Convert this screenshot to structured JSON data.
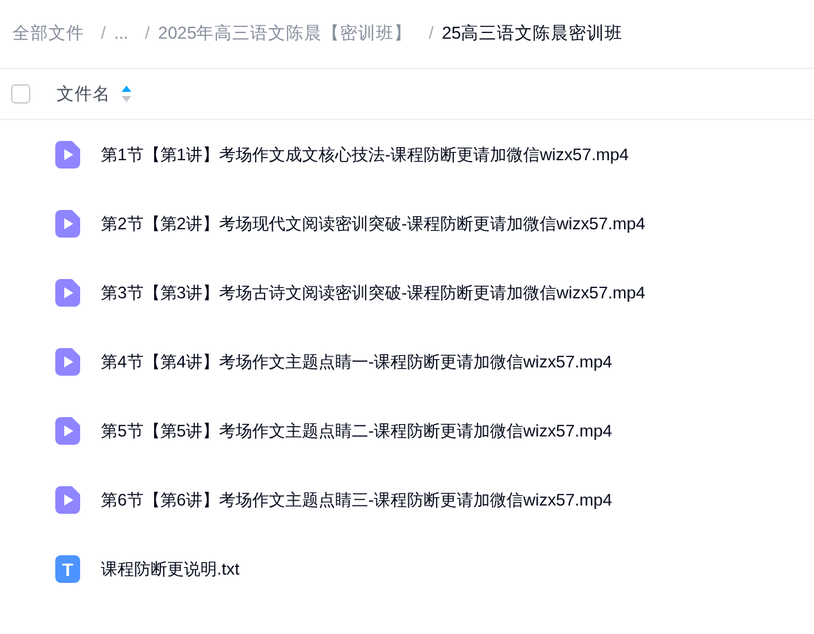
{
  "breadcrumb": {
    "separator": "/",
    "items": [
      {
        "label": "全部文件",
        "selected": false
      },
      {
        "label": "...",
        "selected": false
      },
      {
        "label": "2025年高三语文陈晨【密训班】",
        "selected": false
      },
      {
        "label": "25高三语文陈晨密训班",
        "selected": true
      }
    ]
  },
  "header": {
    "checked": false,
    "column": "文件名",
    "sort_ascending": true
  },
  "files": [
    {
      "kind": "video",
      "name": "第1节【第1讲】考场作文成文核心技法-课程防断更请加微信wizx57.mp4"
    },
    {
      "kind": "video",
      "name": "第2节【第2讲】考场现代文阅读密训突破-课程防断更请加微信wizx57.mp4"
    },
    {
      "kind": "video",
      "name": "第3节【第3讲】考场古诗文阅读密训突破-课程防断更请加微信wizx57.mp4"
    },
    {
      "kind": "video",
      "name": "第4节【第4讲】考场作文主题点睛一-课程防断更请加微信wizx57.mp4"
    },
    {
      "kind": "video",
      "name": "第5节【第5讲】考场作文主题点睛二-课程防断更请加微信wizx57.mp4"
    },
    {
      "kind": "video",
      "name": "第6节【第6讲】考场作文主题点睛三-课程防断更请加微信wizx57.mp4"
    },
    {
      "kind": "text",
      "icon_label": "T",
      "name": "课程防断更说明.txt"
    }
  ]
}
